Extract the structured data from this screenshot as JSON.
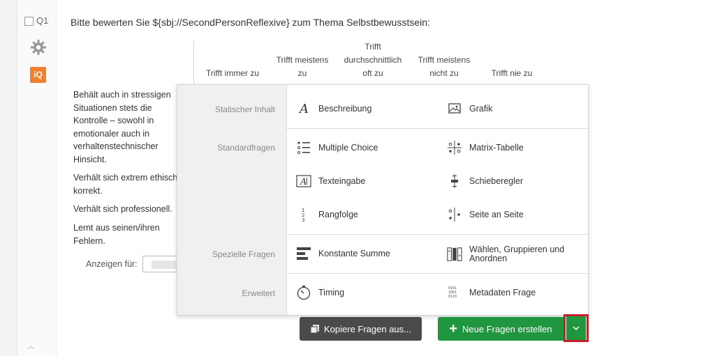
{
  "question": {
    "id": "Q1",
    "text": "Bitte bewerten Sie ${sbj://SecondPersonReflexive} zum Thema Selbstbewusstsein:",
    "columns": [
      [
        "Trifft immer zu"
      ],
      [
        "Trifft meistens",
        "zu"
      ],
      [
        "Trifft",
        "durchschnittlich",
        "oft zu"
      ],
      [
        "Trifft meistens",
        "nicht zu"
      ],
      [
        "Trifft nie zu"
      ]
    ],
    "statements": [
      [
        "Behält auch in stressigen",
        "Situationen stets die",
        "Kontrolle – sowohl in",
        "emotionaler auch in",
        "verhaltenstechnischer",
        "Hinsicht."
      ],
      [
        "Verhält sich extrem ethisch",
        "korrekt."
      ],
      [
        "Verhält sich professionell."
      ],
      [
        "Lernt aus seinen/ihren",
        "Fehlern."
      ]
    ],
    "display_for_label": "Anzeigen für:"
  },
  "sidebar": {
    "iq_label": "iQ",
    "icons": [
      "checkbox-icon",
      "gear-icon",
      "iq-icon"
    ]
  },
  "menu": {
    "categories": [
      "Statischer Inhalt",
      "Standardfragen",
      "Spezielle Fragen",
      "Erweitert"
    ],
    "items": {
      "beschreibung": "Beschreibung",
      "grafik": "Grafik",
      "multiple_choice": "Multiple Choice",
      "matrix": "Matrix-Tabelle",
      "texteingabe": "Texteingabe",
      "schieberegler": "Schieberegler",
      "rangfolge": "Rangfolge",
      "seite_an_seite": "Seite an Seite",
      "konstante_summe": "Konstante Summe",
      "waehlen_1": "Wählen, Gruppieren und",
      "waehlen_2": "Anordnen",
      "timing": "Timing",
      "metadaten": "Metadaten Frage"
    }
  },
  "buttons": {
    "copy": "Kopiere Fragen aus...",
    "new": "Neue Fragen erstellen"
  },
  "colors": {
    "green": "#20973e",
    "highlight": "#c8202a",
    "iq_orange": "#f08030",
    "copy_button": "#4a4a4a"
  }
}
